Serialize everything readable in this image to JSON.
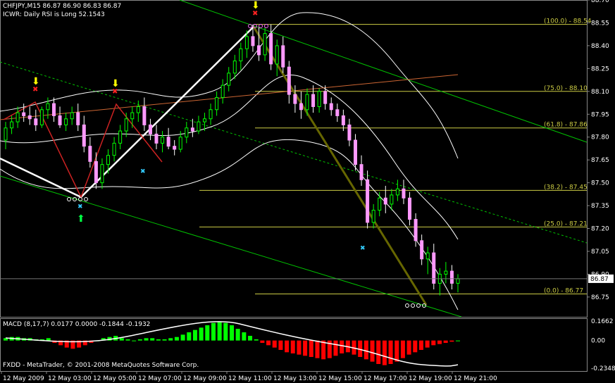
{
  "header": {
    "symbol_line": "CHFJPY,M15  86.87 86.90 86.83 86.87",
    "indicator_line": "ICWR: Daily RSI is Long 52.1543"
  },
  "macd": {
    "label": "MACD  (8,17,7) 0.0177 0.0000 -0.1844 -0.1932"
  },
  "footer": {
    "broker": "FXDD - MetaTrader, © 2001-2008 MetaQuotes Software Corp."
  },
  "colors": {
    "background": "#000000",
    "bull": "#00ff00",
    "bear": "#ffffff",
    "bear_body": "#ff99ff",
    "fib": "#cccc44",
    "channel": "#00c000",
    "bands": "#ffffff",
    "macd_up": "#00ff00",
    "macd_down": "#ff0000",
    "trend_thick": "#666600",
    "marker_x": "#ff2222",
    "marker_arrow": "#ffff00",
    "marker_cyan": "#33ccff"
  },
  "chart_data": {
    "type": "candlestick",
    "symbol": "CHFJPY",
    "timeframe": "M15",
    "ylim": [
      86.62,
      88.7
    ],
    "price_ticks": [
      "88.70",
      "88.55",
      "88.40",
      "88.25",
      "88.10",
      "87.95",
      "87.80",
      "87.65",
      "87.50",
      "87.35",
      "87.20",
      "87.05",
      "86.90",
      "86.75"
    ],
    "current_price": "86.87",
    "time_labels": [
      "12 May 2009",
      "12 May 03:00",
      "12 May 05:00",
      "12 May 07:00",
      "12 May 09:00",
      "12 May 11:00",
      "12 May 13:00",
      "12 May 15:00",
      "12 May 17:00",
      "12 May 19:00",
      "12 May 21:00"
    ],
    "fibonacci_levels": [
      {
        "label": "(100.0) - 88.54",
        "price": 88.54
      },
      {
        "label": "(75.0) - 88.10",
        "price": 88.1
      },
      {
        "label": "(61.8) - 87.86",
        "price": 87.86
      },
      {
        "label": "(38.2) - 87.45",
        "price": 87.45
      },
      {
        "label": "(25.0) - 87.21",
        "price": 87.21
      },
      {
        "label": "(0.0) - 86.77",
        "price": 86.77
      }
    ],
    "macd_ticks": [
      "0.1662",
      "0.00",
      "-0.2348"
    ],
    "macd_ylim": [
      -0.26,
      0.19
    ],
    "candles": [
      {
        "o": 87.78,
        "h": 87.9,
        "l": 87.72,
        "c": 87.86
      },
      {
        "o": 87.86,
        "h": 87.94,
        "l": 87.82,
        "c": 87.9
      },
      {
        "o": 87.9,
        "h": 88.0,
        "l": 87.86,
        "c": 87.96
      },
      {
        "o": 87.96,
        "h": 88.02,
        "l": 87.9,
        "c": 87.94
      },
      {
        "o": 87.94,
        "h": 88.0,
        "l": 87.88,
        "c": 87.92
      },
      {
        "o": 87.92,
        "h": 87.98,
        "l": 87.84,
        "c": 87.88
      },
      {
        "o": 87.88,
        "h": 88.0,
        "l": 87.86,
        "c": 87.98
      },
      {
        "o": 87.98,
        "h": 88.06,
        "l": 87.92,
        "c": 88.02
      },
      {
        "o": 88.02,
        "h": 88.06,
        "l": 87.9,
        "c": 87.94
      },
      {
        "o": 87.94,
        "h": 88.0,
        "l": 87.86,
        "c": 87.88
      },
      {
        "o": 87.88,
        "h": 87.96,
        "l": 87.84,
        "c": 87.92
      },
      {
        "o": 87.92,
        "h": 88.0,
        "l": 87.88,
        "c": 87.96
      },
      {
        "o": 87.96,
        "h": 88.02,
        "l": 87.84,
        "c": 87.88
      },
      {
        "o": 87.88,
        "h": 87.94,
        "l": 87.7,
        "c": 87.74
      },
      {
        "o": 87.74,
        "h": 87.8,
        "l": 87.6,
        "c": 87.64
      },
      {
        "o": 87.64,
        "h": 87.7,
        "l": 87.46,
        "c": 87.5
      },
      {
        "o": 87.5,
        "h": 87.66,
        "l": 87.46,
        "c": 87.62
      },
      {
        "o": 87.62,
        "h": 87.72,
        "l": 87.56,
        "c": 87.68
      },
      {
        "o": 87.68,
        "h": 87.8,
        "l": 87.64,
        "c": 87.76
      },
      {
        "o": 87.76,
        "h": 87.88,
        "l": 87.72,
        "c": 87.84
      },
      {
        "o": 87.84,
        "h": 87.96,
        "l": 87.8,
        "c": 87.92
      },
      {
        "o": 87.92,
        "h": 88.0,
        "l": 87.86,
        "c": 87.96
      },
      {
        "o": 87.96,
        "h": 88.04,
        "l": 87.9,
        "c": 88.0
      },
      {
        "o": 88.0,
        "h": 88.06,
        "l": 87.84,
        "c": 87.88
      },
      {
        "o": 87.88,
        "h": 87.92,
        "l": 87.78,
        "c": 87.82
      },
      {
        "o": 87.82,
        "h": 87.88,
        "l": 87.72,
        "c": 87.76
      },
      {
        "o": 87.76,
        "h": 87.84,
        "l": 87.7,
        "c": 87.8
      },
      {
        "o": 87.8,
        "h": 87.86,
        "l": 87.72,
        "c": 87.74
      },
      {
        "o": 87.74,
        "h": 87.78,
        "l": 87.68,
        "c": 87.72
      },
      {
        "o": 87.72,
        "h": 87.84,
        "l": 87.7,
        "c": 87.8
      },
      {
        "o": 87.8,
        "h": 87.9,
        "l": 87.76,
        "c": 87.86
      },
      {
        "o": 87.86,
        "h": 87.92,
        "l": 87.8,
        "c": 87.84
      },
      {
        "o": 87.84,
        "h": 87.94,
        "l": 87.82,
        "c": 87.9
      },
      {
        "o": 87.9,
        "h": 87.96,
        "l": 87.84,
        "c": 87.92
      },
      {
        "o": 87.92,
        "h": 88.02,
        "l": 87.88,
        "c": 87.98
      },
      {
        "o": 87.98,
        "h": 88.1,
        "l": 87.94,
        "c": 88.06
      },
      {
        "o": 88.06,
        "h": 88.18,
        "l": 88.02,
        "c": 88.14
      },
      {
        "o": 88.14,
        "h": 88.26,
        "l": 88.1,
        "c": 88.22
      },
      {
        "o": 88.22,
        "h": 88.34,
        "l": 88.18,
        "c": 88.3
      },
      {
        "o": 88.3,
        "h": 88.42,
        "l": 88.24,
        "c": 88.38
      },
      {
        "o": 88.38,
        "h": 88.5,
        "l": 88.32,
        "c": 88.46
      },
      {
        "o": 88.46,
        "h": 88.54,
        "l": 88.36,
        "c": 88.4
      },
      {
        "o": 88.4,
        "h": 88.52,
        "l": 88.3,
        "c": 88.34
      },
      {
        "o": 88.34,
        "h": 88.52,
        "l": 88.3,
        "c": 88.48
      },
      {
        "o": 88.48,
        "h": 88.54,
        "l": 88.24,
        "c": 88.28
      },
      {
        "o": 88.28,
        "h": 88.44,
        "l": 88.2,
        "c": 88.4
      },
      {
        "o": 88.4,
        "h": 88.46,
        "l": 88.22,
        "c": 88.26
      },
      {
        "o": 88.26,
        "h": 88.3,
        "l": 88.02,
        "c": 88.08
      },
      {
        "o": 88.08,
        "h": 88.14,
        "l": 87.96,
        "c": 88.02
      },
      {
        "o": 88.02,
        "h": 88.1,
        "l": 87.92,
        "c": 87.98
      },
      {
        "o": 87.98,
        "h": 88.12,
        "l": 87.94,
        "c": 88.08
      },
      {
        "o": 88.08,
        "h": 88.14,
        "l": 87.96,
        "c": 88.0
      },
      {
        "o": 88.0,
        "h": 88.12,
        "l": 87.96,
        "c": 88.1
      },
      {
        "o": 88.1,
        "h": 88.14,
        "l": 87.98,
        "c": 88.02
      },
      {
        "o": 88.02,
        "h": 88.06,
        "l": 87.94,
        "c": 87.98
      },
      {
        "o": 87.98,
        "h": 88.02,
        "l": 87.9,
        "c": 87.94
      },
      {
        "o": 87.94,
        "h": 87.98,
        "l": 87.84,
        "c": 87.88
      },
      {
        "o": 87.88,
        "h": 87.92,
        "l": 87.74,
        "c": 87.78
      },
      {
        "o": 87.78,
        "h": 87.82,
        "l": 87.58,
        "c": 87.62
      },
      {
        "o": 87.62,
        "h": 87.68,
        "l": 87.48,
        "c": 87.52
      },
      {
        "o": 87.52,
        "h": 87.58,
        "l": 87.2,
        "c": 87.24
      },
      {
        "o": 87.24,
        "h": 87.36,
        "l": 87.2,
        "c": 87.32
      },
      {
        "o": 87.32,
        "h": 87.44,
        "l": 87.28,
        "c": 87.4
      },
      {
        "o": 87.4,
        "h": 87.48,
        "l": 87.3,
        "c": 87.36
      },
      {
        "o": 87.36,
        "h": 87.46,
        "l": 87.32,
        "c": 87.42
      },
      {
        "o": 87.42,
        "h": 87.52,
        "l": 87.38,
        "c": 87.46
      },
      {
        "o": 87.46,
        "h": 87.52,
        "l": 87.36,
        "c": 87.4
      },
      {
        "o": 87.4,
        "h": 87.44,
        "l": 87.22,
        "c": 87.26
      },
      {
        "o": 87.26,
        "h": 87.3,
        "l": 87.08,
        "c": 87.12
      },
      {
        "o": 87.12,
        "h": 87.16,
        "l": 86.96,
        "c": 87.0
      },
      {
        "o": 87.0,
        "h": 87.08,
        "l": 86.9,
        "c": 87.04
      },
      {
        "o": 87.04,
        "h": 87.1,
        "l": 86.8,
        "c": 86.84
      },
      {
        "o": 86.84,
        "h": 86.94,
        "l": 86.76,
        "c": 86.9
      },
      {
        "o": 86.9,
        "h": 86.98,
        "l": 86.84,
        "c": 86.92
      },
      {
        "o": 86.92,
        "h": 86.96,
        "l": 86.8,
        "c": 86.84
      },
      {
        "o": 86.84,
        "h": 86.9,
        "l": 86.78,
        "c": 86.87
      }
    ],
    "macd_histogram": [
      0.02,
      0.03,
      0.03,
      0.02,
      0.02,
      0.01,
      0.01,
      0.02,
      -0.02,
      -0.04,
      -0.06,
      -0.07,
      -0.06,
      -0.04,
      -0.02,
      0.0,
      0.02,
      0.03,
      0.04,
      0.02,
      0.01,
      0.0,
      0.01,
      0.02,
      0.02,
      0.01,
      0.01,
      0.02,
      0.03,
      0.05,
      0.07,
      0.09,
      0.11,
      0.13,
      0.15,
      0.16,
      0.15,
      0.13,
      0.1,
      0.07,
      0.04,
      0.01,
      -0.02,
      -0.04,
      -0.06,
      -0.08,
      -0.1,
      -0.11,
      -0.12,
      -0.13,
      -0.14,
      -0.15,
      -0.16,
      -0.15,
      -0.13,
      -0.11,
      -0.1,
      -0.12,
      -0.14,
      -0.16,
      -0.18,
      -0.2,
      -0.21,
      -0.2,
      -0.18,
      -0.15,
      -0.12,
      -0.1,
      -0.08,
      -0.06,
      -0.04,
      -0.03,
      -0.02,
      -0.01,
      0.0
    ]
  }
}
